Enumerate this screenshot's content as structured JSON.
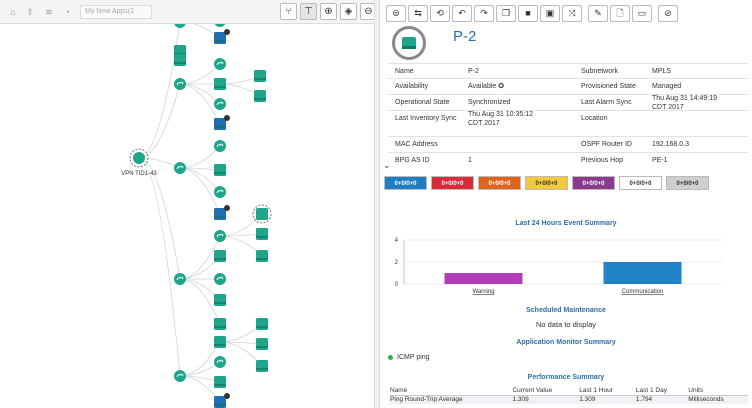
{
  "left_toolbar": {
    "app_select": "My New Apps(2",
    "view_buttons": [
      {
        "name": "fork-icon",
        "glyph": "⑂"
      },
      {
        "name": "hierarchy-icon",
        "glyph": "⊤"
      },
      {
        "name": "zoom-in-icon",
        "glyph": "⊕"
      },
      {
        "name": "center-icon",
        "glyph": "◈"
      },
      {
        "name": "zoom-out-icon",
        "glyph": "⊖"
      }
    ]
  },
  "topology": {
    "root_label": "VPN TID1-43"
  },
  "action_toolbar": [
    {
      "name": "expand-icon",
      "glyph": "⊜"
    },
    {
      "name": "sync-icon",
      "glyph": "⇆"
    },
    {
      "name": "refresh-icon",
      "glyph": "⟲"
    },
    {
      "name": "undo-icon",
      "glyph": "↶"
    },
    {
      "name": "redo-icon",
      "glyph": "↷"
    },
    {
      "name": "copy-icon",
      "glyph": "❐"
    },
    {
      "name": "stop-icon",
      "glyph": "■"
    },
    {
      "name": "delete-icon",
      "glyph": "▣"
    },
    {
      "name": "shuffle-icon",
      "glyph": "⤨"
    },
    {
      "name": "edit-icon",
      "glyph": "✎"
    },
    {
      "name": "document-icon",
      "glyph": "🗋"
    },
    {
      "name": "laptop-icon",
      "glyph": "▭"
    },
    {
      "name": "attach-icon",
      "glyph": "⊘"
    }
  ],
  "device": {
    "title": "P-2"
  },
  "properties": {
    "left": [
      {
        "label": "Name",
        "value": "P-2"
      },
      {
        "label": "Availability",
        "value": "Available ✪"
      },
      {
        "label": "Operational State",
        "value": "Synchronized"
      },
      {
        "label": "Last Inventory Sync",
        "value": "Thu Aug 31 10:35:12",
        "value2": "CDT 2017"
      },
      {
        "label": "MAC Address",
        "value": ""
      },
      {
        "label": "BPG AS ID",
        "value": "1"
      }
    ],
    "right": [
      {
        "label": "Subnetwork",
        "value": "MPLS"
      },
      {
        "label": "Provisioned State",
        "value": "Managed"
      },
      {
        "label": "Last Alarm Sync",
        "value": "Thu Aug 31 14:49:19",
        "value2": "CDT 2017"
      },
      {
        "label": "Location",
        "value": ""
      },
      {
        "label": "OSPF Router ID",
        "value": "192.168.0.3"
      },
      {
        "label": "Previous Hop",
        "value": "PE-1"
      }
    ]
  },
  "severity_counts": [
    {
      "text": "0+0/0+0",
      "bg": "#1f7ec2",
      "fg": "#ffffff"
    },
    {
      "text": "0+0/0+0",
      "bg": "#d92b3a",
      "fg": "#ffffff"
    },
    {
      "text": "0+0/0+0",
      "bg": "#e0651c",
      "fg": "#ffffff"
    },
    {
      "text": "0+0/0+0",
      "bg": "#f3c93c",
      "fg": "#333333"
    },
    {
      "text": "0+0/0+0",
      "bg": "#8a3b8f",
      "fg": "#ffffff"
    },
    {
      "text": "0+0/0+0",
      "bg": "#ffffff",
      "fg": "#333333"
    },
    {
      "text": "0+0/0+0",
      "bg": "#cfcfcf",
      "fg": "#333333"
    }
  ],
  "event_summary": {
    "title": "Last 24 Hours Event Summary"
  },
  "chart_data": {
    "type": "bar",
    "categories": [
      "Warning",
      "Communication"
    ],
    "values": [
      1,
      2
    ],
    "colors": [
      "#b33cb8",
      "#1f84c8"
    ],
    "yticks": [
      0,
      2,
      4
    ],
    "ylim": [
      0,
      4
    ],
    "title": "Last 24 Hours Event Summary"
  },
  "maintenance": {
    "title": "Scheduled Maintenance",
    "empty_text": "No data to display"
  },
  "app_monitor": {
    "title": "Application Monitor Summary",
    "item": "ICMP ping"
  },
  "performance": {
    "title": "Performance Summary",
    "headers": [
      "Name",
      "Current Value",
      "Last 1 Hour",
      "Last 1 Day",
      "Units"
    ],
    "row": [
      "Ping Round-Trip Average",
      "1.309",
      "1.309",
      "1.794",
      "Milliseconds"
    ]
  }
}
